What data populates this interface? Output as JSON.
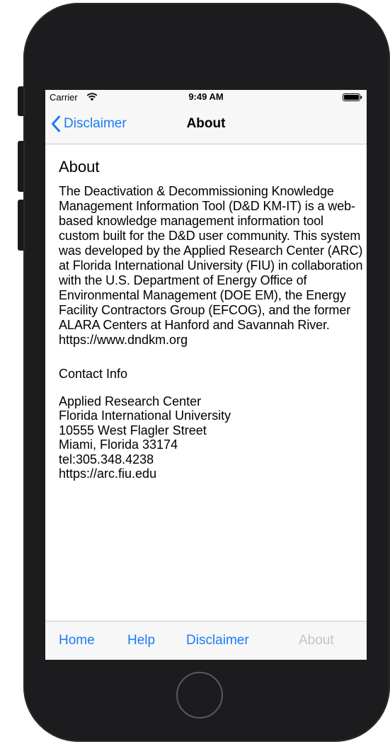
{
  "status_bar": {
    "carrier": "Carrier",
    "time": "9:49 AM",
    "wifi_icon": "wifi-icon",
    "battery_icon": "battery-icon"
  },
  "nav_bar": {
    "back_label": "Disclaimer",
    "title": "About",
    "back_icon": "chevron-left-icon"
  },
  "content": {
    "heading": "About",
    "paragraph": "The Deactivation & Decommissioning Knowledge Management Information Tool (D&D KM-IT) is a web-based knowledge management information tool custom built for the D&D user community. This system was developed by the Applied Research Center (ARC) at Florida International University (FIU) in collaboration with the U.S. Department of Energy Office of Environmental Management (DOE EM), the Energy Facility Contractors Group (EFCOG), and the former ALARA Centers at Hanford and Savannah River.",
    "url": "https://www.dndkm.org",
    "contact_heading": "Contact Info",
    "contact_lines": [
      "Applied Research Center",
      "Florida International University",
      "10555 West Flagler Street",
      "Miami, Florida 33174",
      "tel:305.348.4238",
      "https://arc.fiu.edu"
    ]
  },
  "tab_bar": {
    "tabs": [
      {
        "label": "Home",
        "selected": false
      },
      {
        "label": "Help",
        "selected": false
      },
      {
        "label": "Disclaimer",
        "selected": false
      },
      {
        "label": "About",
        "selected": true
      }
    ]
  },
  "colors": {
    "accent": "#1a7cf5",
    "disabled": "#c4c4c6",
    "bar_background": "#f7f7f7",
    "device_body": "#1c1c1e"
  }
}
